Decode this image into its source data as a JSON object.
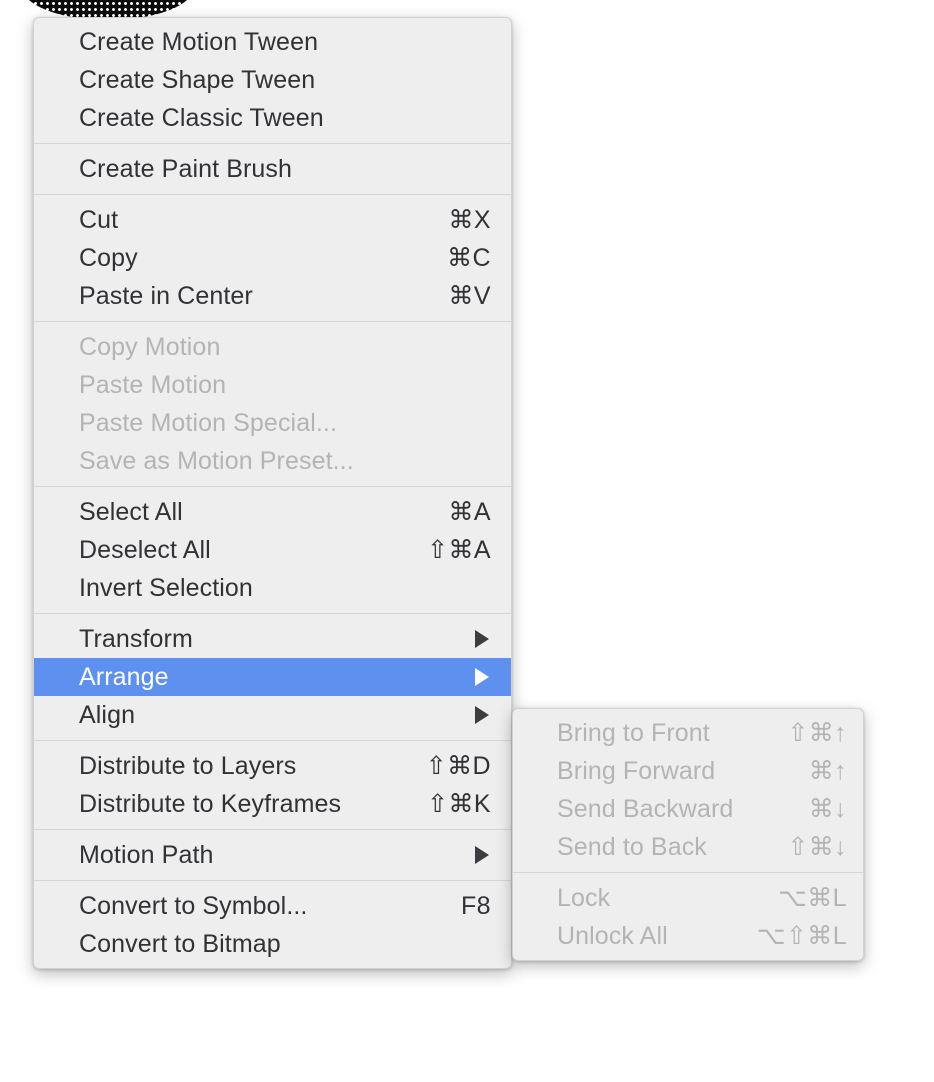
{
  "canvas": {
    "shape_name": "selected-ellipse-artwork",
    "fill_color": "#0b0b0b",
    "pattern": "halftone-dots"
  },
  "theme": {
    "menu_background": "#eeeeee",
    "separator_color": "#d6d6d6",
    "text_color": "#303236",
    "disabled_text_color": "#b4b4b4",
    "highlight_color": "#5d90ef",
    "highlight_text_color": "#ffffff"
  },
  "context_menu": {
    "name": "modify-context-menu",
    "groups": [
      {
        "items": [
          {
            "label": "Create Motion Tween",
            "shortcut": "",
            "arrow": false,
            "disabled": false,
            "selected": false
          },
          {
            "label": "Create Shape Tween",
            "shortcut": "",
            "arrow": false,
            "disabled": false,
            "selected": false
          },
          {
            "label": "Create Classic Tween",
            "shortcut": "",
            "arrow": false,
            "disabled": false,
            "selected": false
          }
        ]
      },
      {
        "items": [
          {
            "label": "Create Paint Brush",
            "shortcut": "",
            "arrow": false,
            "disabled": false,
            "selected": false
          }
        ]
      },
      {
        "items": [
          {
            "label": "Cut",
            "shortcut": "⌘X",
            "arrow": false,
            "disabled": false,
            "selected": false
          },
          {
            "label": "Copy",
            "shortcut": "⌘C",
            "arrow": false,
            "disabled": false,
            "selected": false
          },
          {
            "label": "Paste in Center",
            "shortcut": "⌘V",
            "arrow": false,
            "disabled": false,
            "selected": false
          }
        ]
      },
      {
        "items": [
          {
            "label": "Copy Motion",
            "shortcut": "",
            "arrow": false,
            "disabled": true,
            "selected": false
          },
          {
            "label": "Paste Motion",
            "shortcut": "",
            "arrow": false,
            "disabled": true,
            "selected": false
          },
          {
            "label": "Paste Motion Special...",
            "shortcut": "",
            "arrow": false,
            "disabled": true,
            "selected": false
          },
          {
            "label": "Save as Motion Preset...",
            "shortcut": "",
            "arrow": false,
            "disabled": true,
            "selected": false
          }
        ]
      },
      {
        "items": [
          {
            "label": "Select All",
            "shortcut": "⌘A",
            "arrow": false,
            "disabled": false,
            "selected": false
          },
          {
            "label": "Deselect All",
            "shortcut": "⇧⌘A",
            "arrow": false,
            "disabled": false,
            "selected": false
          },
          {
            "label": "Invert Selection",
            "shortcut": "",
            "arrow": false,
            "disabled": false,
            "selected": false
          }
        ]
      },
      {
        "items": [
          {
            "label": "Transform",
            "shortcut": "",
            "arrow": true,
            "disabled": false,
            "selected": false
          },
          {
            "label": "Arrange",
            "shortcut": "",
            "arrow": true,
            "disabled": false,
            "selected": true
          },
          {
            "label": "Align",
            "shortcut": "",
            "arrow": true,
            "disabled": false,
            "selected": false
          }
        ]
      },
      {
        "items": [
          {
            "label": "Distribute to Layers",
            "shortcut": "⇧⌘D",
            "arrow": false,
            "disabled": false,
            "selected": false
          },
          {
            "label": "Distribute to Keyframes",
            "shortcut": "⇧⌘K",
            "arrow": false,
            "disabled": false,
            "selected": false
          }
        ]
      },
      {
        "items": [
          {
            "label": "Motion Path",
            "shortcut": "",
            "arrow": true,
            "disabled": false,
            "selected": false
          }
        ]
      },
      {
        "items": [
          {
            "label": "Convert to Symbol...",
            "shortcut": "F8",
            "arrow": false,
            "disabled": false,
            "selected": false
          },
          {
            "label": "Convert to Bitmap",
            "shortcut": "",
            "arrow": false,
            "disabled": false,
            "selected": false
          }
        ]
      }
    ]
  },
  "submenu": {
    "name": "arrange-submenu",
    "parent_item": "Arrange",
    "groups": [
      {
        "items": [
          {
            "label": "Bring to Front",
            "shortcut": "⇧⌘↑",
            "arrow": false,
            "disabled": true,
            "selected": false
          },
          {
            "label": "Bring Forward",
            "shortcut": "⌘↑",
            "arrow": false,
            "disabled": true,
            "selected": false
          },
          {
            "label": "Send Backward",
            "shortcut": "⌘↓",
            "arrow": false,
            "disabled": true,
            "selected": false
          },
          {
            "label": "Send to Back",
            "shortcut": "⇧⌘↓",
            "arrow": false,
            "disabled": true,
            "selected": false
          }
        ]
      },
      {
        "items": [
          {
            "label": "Lock",
            "shortcut": "⌥⌘L",
            "arrow": false,
            "disabled": true,
            "selected": false
          },
          {
            "label": "Unlock All",
            "shortcut": "⌥⇧⌘L",
            "arrow": false,
            "disabled": true,
            "selected": false
          }
        ]
      }
    ]
  }
}
